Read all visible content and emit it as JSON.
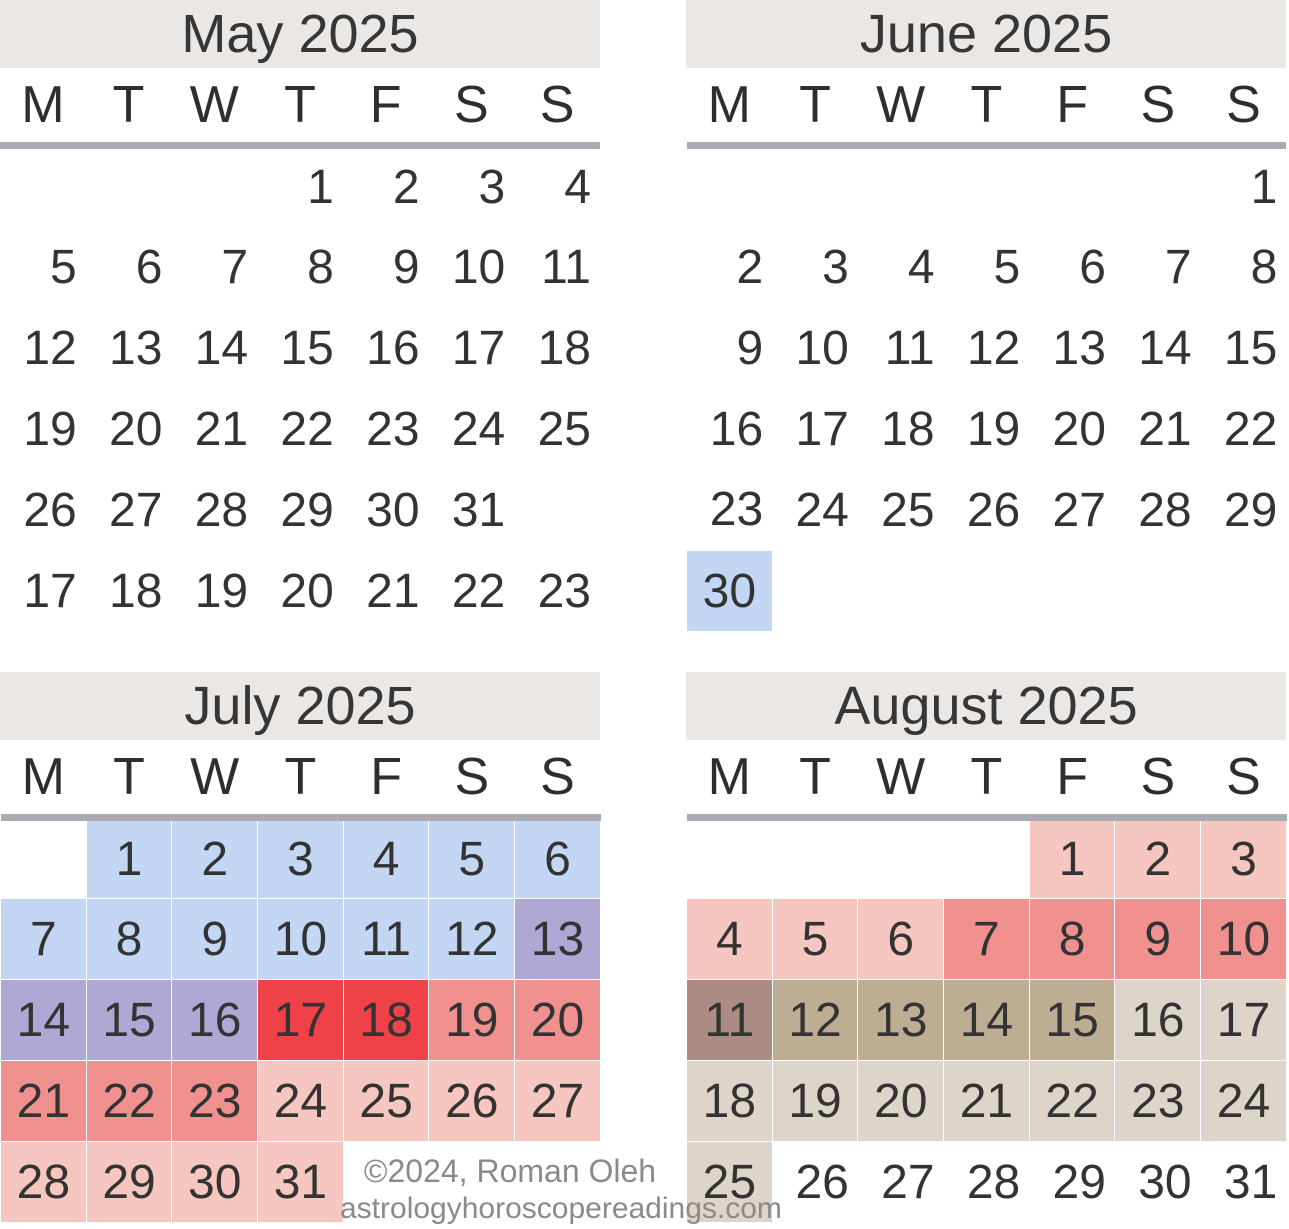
{
  "page": {
    "background": "#ffffff",
    "title_bar_bg": "#eae7e5",
    "separator_color": "#a9abb0",
    "text_color": "#333333"
  },
  "footer": {
    "copyright": "©2024, Roman Oleh",
    "website": "astrologyhoroscopereadings.com"
  },
  "weekday_headers": [
    "M",
    "T",
    "W",
    "T",
    "F",
    "S",
    "S"
  ],
  "legend_colors": {
    "blue": "#c3d7f5",
    "purple": "#afa7d4",
    "red_bright": "#ef4148",
    "salmon": "#f1918f",
    "pink_light": "#f6c6c0",
    "pink_pale": "#f7cfc8",
    "brown_dark": "#ab8c85",
    "tan": "#bdae93",
    "beige": "#ded5ca",
    "highlight_blue": "#c3d7f5"
  },
  "months": [
    {
      "id": "may",
      "title": "May 2025",
      "weeks": [
        [
          {
            "label": "",
            "bg": ""
          },
          {
            "label": "",
            "bg": ""
          },
          {
            "label": "",
            "bg": ""
          },
          {
            "label": "1",
            "bg": ""
          },
          {
            "label": "2",
            "bg": ""
          },
          {
            "label": "3",
            "bg": ""
          },
          {
            "label": "4",
            "bg": ""
          }
        ],
        [
          {
            "label": "5",
            "bg": ""
          },
          {
            "label": "6",
            "bg": ""
          },
          {
            "label": "7",
            "bg": ""
          },
          {
            "label": "8",
            "bg": ""
          },
          {
            "label": "9",
            "bg": ""
          },
          {
            "label": "10",
            "bg": ""
          },
          {
            "label": "11",
            "bg": ""
          }
        ],
        [
          {
            "label": "12",
            "bg": ""
          },
          {
            "label": "13",
            "bg": ""
          },
          {
            "label": "14",
            "bg": ""
          },
          {
            "label": "15",
            "bg": ""
          },
          {
            "label": "16",
            "bg": ""
          },
          {
            "label": "17",
            "bg": ""
          },
          {
            "label": "18",
            "bg": ""
          }
        ],
        [
          {
            "label": "19",
            "bg": ""
          },
          {
            "label": "20",
            "bg": ""
          },
          {
            "label": "21",
            "bg": ""
          },
          {
            "label": "22",
            "bg": ""
          },
          {
            "label": "23",
            "bg": ""
          },
          {
            "label": "24",
            "bg": ""
          },
          {
            "label": "25",
            "bg": ""
          }
        ],
        [
          {
            "label": "26",
            "bg": ""
          },
          {
            "label": "27",
            "bg": ""
          },
          {
            "label": "28",
            "bg": ""
          },
          {
            "label": "29",
            "bg": ""
          },
          {
            "label": "30",
            "bg": ""
          },
          {
            "label": "31",
            "bg": ""
          },
          {
            "label": "",
            "bg": ""
          }
        ],
        [
          {
            "label": "17",
            "bg": ""
          },
          {
            "label": "18",
            "bg": ""
          },
          {
            "label": "19",
            "bg": ""
          },
          {
            "label": "20",
            "bg": ""
          },
          {
            "label": "21",
            "bg": ""
          },
          {
            "label": "22",
            "bg": ""
          },
          {
            "label": "23",
            "bg": ""
          }
        ]
      ]
    },
    {
      "id": "june",
      "title": "June 2025",
      "weeks": [
        [
          {
            "label": "",
            "bg": ""
          },
          {
            "label": "",
            "bg": ""
          },
          {
            "label": "",
            "bg": ""
          },
          {
            "label": "",
            "bg": ""
          },
          {
            "label": "",
            "bg": ""
          },
          {
            "label": "",
            "bg": ""
          },
          {
            "label": "1",
            "bg": ""
          }
        ],
        [
          {
            "label": "2",
            "bg": ""
          },
          {
            "label": "3",
            "bg": ""
          },
          {
            "label": "4",
            "bg": ""
          },
          {
            "label": "5",
            "bg": ""
          },
          {
            "label": "6",
            "bg": ""
          },
          {
            "label": "7",
            "bg": ""
          },
          {
            "label": "8",
            "bg": ""
          }
        ],
        [
          {
            "label": "9",
            "bg": ""
          },
          {
            "label": "10",
            "bg": ""
          },
          {
            "label": "11",
            "bg": ""
          },
          {
            "label": "12",
            "bg": ""
          },
          {
            "label": "13",
            "bg": ""
          },
          {
            "label": "14",
            "bg": ""
          },
          {
            "label": "15",
            "bg": ""
          }
        ],
        [
          {
            "label": "16",
            "bg": ""
          },
          {
            "label": "17",
            "bg": ""
          },
          {
            "label": "18",
            "bg": ""
          },
          {
            "label": "19",
            "bg": ""
          },
          {
            "label": "20",
            "bg": ""
          },
          {
            "label": "21",
            "bg": ""
          },
          {
            "label": "22",
            "bg": ""
          }
        ],
        [
          {
            "label": "23",
            "bg": ""
          },
          {
            "label": "24",
            "bg": ""
          },
          {
            "label": "25",
            "bg": ""
          },
          {
            "label": "26",
            "bg": ""
          },
          {
            "label": "27",
            "bg": ""
          },
          {
            "label": "28",
            "bg": ""
          },
          {
            "label": "29",
            "bg": ""
          }
        ],
        [
          {
            "label": "30",
            "bg": "#c3d7f5"
          },
          {
            "label": "",
            "bg": ""
          },
          {
            "label": "",
            "bg": ""
          },
          {
            "label": "",
            "bg": ""
          },
          {
            "label": "",
            "bg": ""
          },
          {
            "label": "",
            "bg": ""
          },
          {
            "label": "",
            "bg": ""
          }
        ]
      ]
    },
    {
      "id": "july",
      "title": "July 2025",
      "weeks": [
        [
          {
            "label": "",
            "bg": ""
          },
          {
            "label": "1",
            "bg": "#c3d7f5"
          },
          {
            "label": "2",
            "bg": "#c3d7f5"
          },
          {
            "label": "3",
            "bg": "#c3d7f5"
          },
          {
            "label": "4",
            "bg": "#c3d7f5"
          },
          {
            "label": "5",
            "bg": "#c3d7f5"
          },
          {
            "label": "6",
            "bg": "#c3d7f5"
          }
        ],
        [
          {
            "label": "7",
            "bg": "#c3d7f5"
          },
          {
            "label": "8",
            "bg": "#c3d7f5"
          },
          {
            "label": "9",
            "bg": "#c3d7f5"
          },
          {
            "label": "10",
            "bg": "#c3d7f5"
          },
          {
            "label": "11",
            "bg": "#c3d7f5"
          },
          {
            "label": "12",
            "bg": "#c3d7f5"
          },
          {
            "label": "13",
            "bg": "#afa7d4"
          }
        ],
        [
          {
            "label": "14",
            "bg": "#afa7d4"
          },
          {
            "label": "15",
            "bg": "#afa7d4"
          },
          {
            "label": "16",
            "bg": "#afa7d4"
          },
          {
            "label": "17",
            "bg": "#ef4148"
          },
          {
            "label": "18",
            "bg": "#ef4148"
          },
          {
            "label": "19",
            "bg": "#f1918f"
          },
          {
            "label": "20",
            "bg": "#f1918f"
          }
        ],
        [
          {
            "label": "21",
            "bg": "#f1918f"
          },
          {
            "label": "22",
            "bg": "#f1918f"
          },
          {
            "label": "23",
            "bg": "#f1918f"
          },
          {
            "label": "24",
            "bg": "#f6c6c0"
          },
          {
            "label": "25",
            "bg": "#f6c6c0"
          },
          {
            "label": "26",
            "bg": "#f6c6c0"
          },
          {
            "label": "27",
            "bg": "#f6c6c0"
          }
        ],
        [
          {
            "label": "28",
            "bg": "#f6c6c0"
          },
          {
            "label": "29",
            "bg": "#f6c6c0"
          },
          {
            "label": "30",
            "bg": "#f6c6c0"
          },
          {
            "label": "31",
            "bg": "#f6c6c0"
          },
          {
            "label": "",
            "bg": ""
          },
          {
            "label": "",
            "bg": ""
          },
          {
            "label": "",
            "bg": ""
          }
        ]
      ]
    },
    {
      "id": "august",
      "title": "August 2025",
      "weeks": [
        [
          {
            "label": "",
            "bg": ""
          },
          {
            "label": "",
            "bg": ""
          },
          {
            "label": "",
            "bg": ""
          },
          {
            "label": "",
            "bg": ""
          },
          {
            "label": "1",
            "bg": "#f6c6c0"
          },
          {
            "label": "2",
            "bg": "#f6c6c0"
          },
          {
            "label": "3",
            "bg": "#f6c6c0"
          }
        ],
        [
          {
            "label": "4",
            "bg": "#f6c6c0"
          },
          {
            "label": "5",
            "bg": "#f6c6c0"
          },
          {
            "label": "6",
            "bg": "#f6c6c0"
          },
          {
            "label": "7",
            "bg": "#f1918f"
          },
          {
            "label": "8",
            "bg": "#f1918f"
          },
          {
            "label": "9",
            "bg": "#f1918f"
          },
          {
            "label": "10",
            "bg": "#f1918f"
          }
        ],
        [
          {
            "label": "11",
            "bg": "#ab8c85"
          },
          {
            "label": "12",
            "bg": "#bdae93"
          },
          {
            "label": "13",
            "bg": "#bdae93"
          },
          {
            "label": "14",
            "bg": "#bdae93"
          },
          {
            "label": "15",
            "bg": "#bdae93"
          },
          {
            "label": "16",
            "bg": "#ded5ca"
          },
          {
            "label": "17",
            "bg": "#ded5ca"
          }
        ],
        [
          {
            "label": "18",
            "bg": "#ded5ca"
          },
          {
            "label": "19",
            "bg": "#ded5ca"
          },
          {
            "label": "20",
            "bg": "#ded5ca"
          },
          {
            "label": "21",
            "bg": "#ded5ca"
          },
          {
            "label": "22",
            "bg": "#ded5ca"
          },
          {
            "label": "23",
            "bg": "#ded5ca"
          },
          {
            "label": "24",
            "bg": "#ded5ca"
          }
        ],
        [
          {
            "label": "25",
            "bg": "#ded5ca"
          },
          {
            "label": "26",
            "bg": ""
          },
          {
            "label": "27",
            "bg": ""
          },
          {
            "label": "28",
            "bg": ""
          },
          {
            "label": "29",
            "bg": ""
          },
          {
            "label": "30",
            "bg": ""
          },
          {
            "label": "31",
            "bg": ""
          }
        ]
      ]
    }
  ]
}
